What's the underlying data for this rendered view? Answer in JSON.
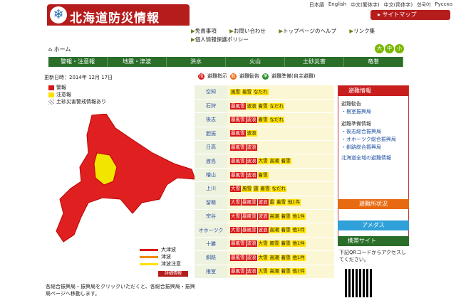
{
  "header": {
    "title": "北海道防災情報",
    "sitemap": "サイトマップ",
    "langs": [
      "日本語",
      "English",
      "中文(繁体字)",
      "中文(简体字)",
      "한국어",
      "Русско"
    ]
  },
  "util": [
    "免責事項",
    "お問い合わせ",
    "トップページのヘルプ",
    "リンク集",
    "個人情報保護ポリシー"
  ],
  "breadcrumb": "ホーム",
  "size_icons": [
    "大",
    "中",
    "小"
  ],
  "nav": [
    "警報・注意報",
    "地震・津波",
    "洪水",
    "火山",
    "土砂災害",
    "竜巻"
  ],
  "updated": "更新日時：2014年 12月 17日",
  "legend": [
    "警報",
    "注意報",
    "土砂災害警戒情報あり"
  ],
  "tsunami_legend": [
    "大津波",
    "津波",
    "津波注意"
  ],
  "detail_btn": "詳細情報",
  "note": "各総合振興局・振興局をクリックいただくと、各総合振興局・振興局ページへ移動します。",
  "table_head": [
    "避難指示",
    "避難勧告",
    "避難準備(自主避難)"
  ],
  "rows": [
    {
      "name": "空知",
      "tags": [
        [
          "y",
          "風雪"
        ],
        [
          "y",
          "着雪"
        ],
        [
          "y",
          "なだれ"
        ]
      ]
    },
    {
      "name": "石狩",
      "tags": [
        [
          "r",
          "暴風雪"
        ],
        [
          "y",
          "波浪"
        ],
        [
          "y",
          "着雪"
        ],
        [
          "y",
          "なだれ"
        ]
      ]
    },
    {
      "name": "後志",
      "tags": [
        [
          "r",
          "暴風雪"
        ],
        [
          "r",
          "波浪"
        ],
        [
          "y",
          "着雪"
        ],
        [
          "y",
          "なだれ"
        ]
      ]
    },
    {
      "name": "胆振",
      "tags": [
        [
          "r",
          "暴風雪"
        ],
        [
          "y",
          "波浪"
        ]
      ]
    },
    {
      "name": "日高",
      "tags": [
        [
          "r",
          "暴風雪"
        ],
        [
          "r",
          "波浪"
        ]
      ]
    },
    {
      "name": "渡島",
      "tags": [
        [
          "r",
          "暴風雪"
        ],
        [
          "r",
          "波浪"
        ],
        [
          "y",
          "大雪"
        ],
        [
          "y",
          "高潮"
        ],
        [
          "y",
          "着雪"
        ]
      ]
    },
    {
      "name": "檜山",
      "tags": [
        [
          "r",
          "暴風雪"
        ],
        [
          "r",
          "波浪"
        ],
        [
          "y",
          "着雪"
        ]
      ]
    },
    {
      "name": "上川",
      "tags": [
        [
          "r",
          "大雪"
        ],
        [
          "y",
          "風雪"
        ],
        [
          "y",
          "雷"
        ],
        [
          "y",
          "着雪"
        ],
        [
          "y",
          "なだれ"
        ]
      ]
    },
    {
      "name": "留萌",
      "tags": [
        [
          "r",
          "大雪"
        ],
        [
          "r",
          "暴風雪"
        ],
        [
          "r",
          "波浪"
        ],
        [
          "y",
          "雷"
        ],
        [
          "y",
          "着雪"
        ],
        [
          "y",
          "他1件"
        ]
      ]
    },
    {
      "name": "宗谷",
      "tags": [
        [
          "r",
          "大雪"
        ],
        [
          "r",
          "暴風雪"
        ],
        [
          "r",
          "波浪"
        ],
        [
          "y",
          "高潮"
        ],
        [
          "y",
          "着雪"
        ],
        [
          "y",
          "他1件"
        ]
      ]
    },
    {
      "name": "オホーツク",
      "tags": [
        [
          "r",
          "大雪"
        ],
        [
          "r",
          "暴風雪"
        ],
        [
          "r",
          "波浪"
        ],
        [
          "y",
          "高潮"
        ],
        [
          "y",
          "着雪"
        ],
        [
          "y",
          "他1件"
        ]
      ]
    },
    {
      "name": "十勝",
      "tags": [
        [
          "r",
          "暴風雪"
        ],
        [
          "r",
          "波浪"
        ],
        [
          "y",
          "大雪"
        ],
        [
          "y",
          "風雪"
        ],
        [
          "y",
          "着雪"
        ],
        [
          "y",
          "他1件"
        ]
      ]
    },
    {
      "name": "釧路",
      "tags": [
        [
          "r",
          "暴風雪"
        ],
        [
          "r",
          "波浪"
        ],
        [
          "y",
          "大雪"
        ],
        [
          "y",
          "高潮"
        ],
        [
          "y",
          "着雪"
        ],
        [
          "y",
          "他1件"
        ]
      ]
    },
    {
      "name": "根室",
      "tags": [
        [
          "r",
          "暴風雪"
        ],
        [
          "r",
          "波浪"
        ],
        [
          "y",
          "大雪"
        ],
        [
          "y",
          "高潮"
        ],
        [
          "y",
          "着雪"
        ],
        [
          "y",
          "他1件"
        ]
      ]
    }
  ],
  "side": {
    "head": "避難情報",
    "s1": "避難勧告",
    "l1": "・根室振興局",
    "s2": "避難準備情報",
    "l2": [
      "・後志総合振興局",
      "・オホーツク総合振興局",
      "・釧路総合振興局"
    ],
    "all": "北海道全域の避難情報",
    "btn1": "避難所状況",
    "btn2": "アメダス",
    "mob": "携帯サイト",
    "mobt": "下記QRコードからアクセスしてください。"
  },
  "colors": {
    "red": "#d81818",
    "yellow": "#ffe100",
    "green": "#2a6e2a"
  }
}
